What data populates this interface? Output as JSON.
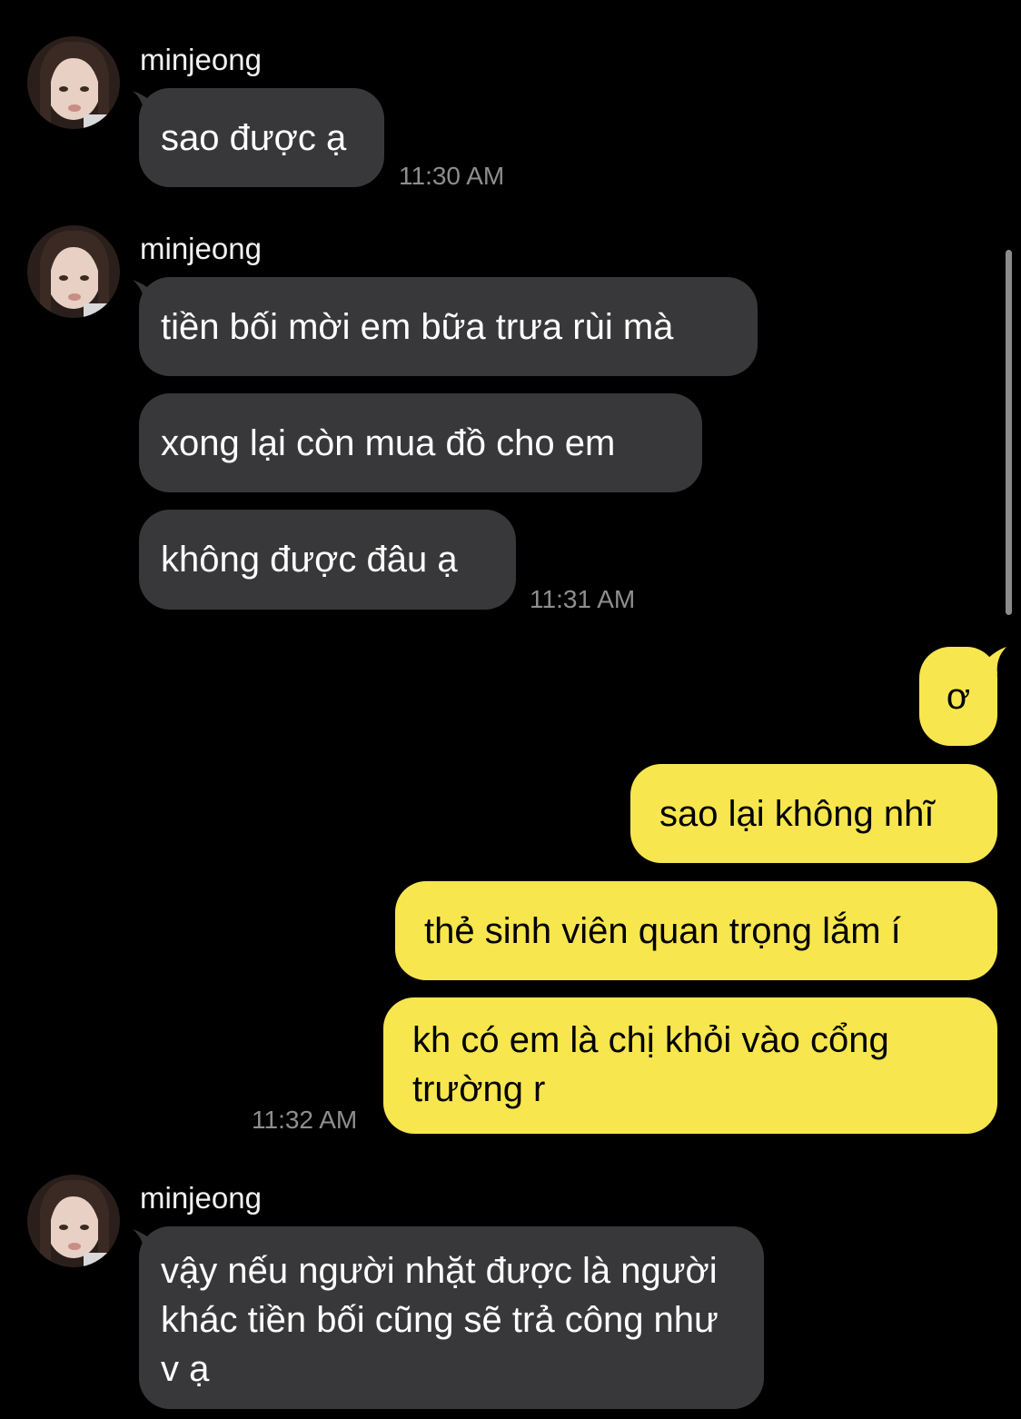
{
  "colors": {
    "background": "#000000",
    "incoming_bubble": "#38383a",
    "outgoing_bubble": "#f8e64f",
    "timestamp": "#8e8e8e"
  },
  "groups": [
    {
      "sender": "minjeong",
      "messages": [
        "sao được ạ"
      ],
      "time": "11:30 AM"
    },
    {
      "sender": "minjeong",
      "messages": [
        "tiền bối mời em bữa trưa rùi mà",
        "xong lại còn mua đồ cho em",
        "không được đâu ạ"
      ],
      "time": "11:31 AM"
    },
    {
      "sender": "me",
      "messages": [
        "ơ",
        "sao lại không nhĩ",
        "thẻ sinh viên quan trọng lắm í",
        "kh có em là chị khỏi vào cổng trường r"
      ],
      "time": "11:32 AM"
    },
    {
      "sender": "minjeong",
      "messages": [
        "vậy nếu người nhặt được là người khác tiền bối cũng sẽ trả công như v ạ"
      ]
    }
  ],
  "icons": {
    "avatar": "profile-photo-icon"
  }
}
